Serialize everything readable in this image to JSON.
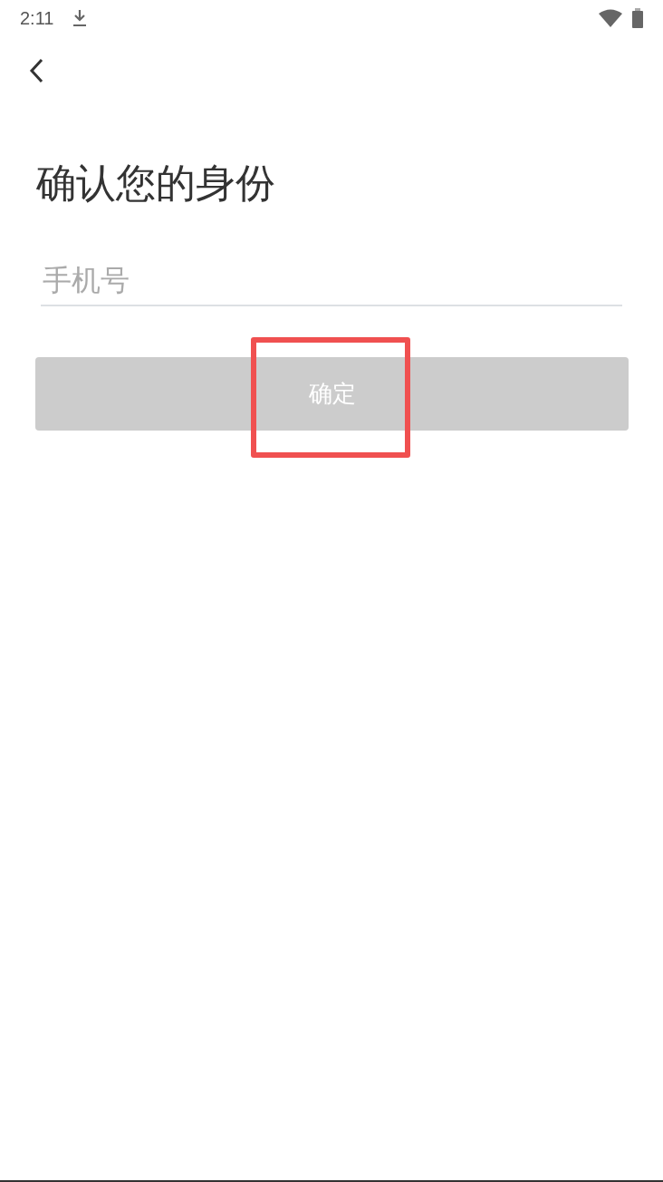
{
  "status_bar": {
    "time": "2:11"
  },
  "title": "确认您的身份",
  "phone_field": {
    "placeholder": "手机号"
  },
  "confirm_button": {
    "label": "确定",
    "disabled": true,
    "highlighted": true
  }
}
